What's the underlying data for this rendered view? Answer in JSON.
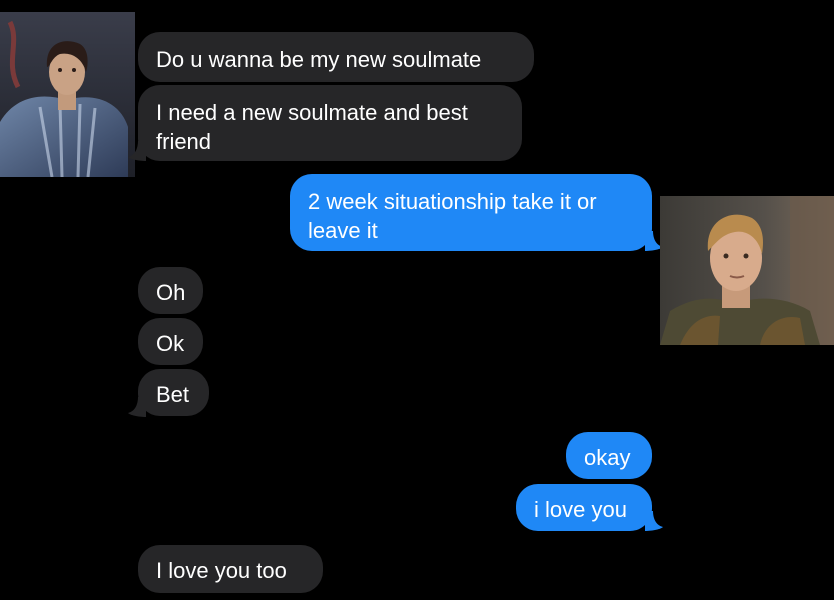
{
  "conversation": {
    "messages": [
      {
        "id": "m1",
        "direction": "received",
        "text": "Do u wanna be my new soulmate"
      },
      {
        "id": "m2",
        "direction": "received",
        "text": "I need a new soulmate and best friend"
      },
      {
        "id": "m3",
        "direction": "sent",
        "text": "2 week situationship take it or leave it"
      },
      {
        "id": "m4",
        "direction": "received",
        "text": "Oh"
      },
      {
        "id": "m5",
        "direction": "received",
        "text": "Ok"
      },
      {
        "id": "m6",
        "direction": "received",
        "text": "Bet"
      },
      {
        "id": "m7",
        "direction": "sent",
        "text": "okay"
      },
      {
        "id": "m8",
        "direction": "sent",
        "text": "i love you"
      },
      {
        "id": "m9",
        "direction": "received",
        "text": "I love you too"
      }
    ]
  },
  "colors": {
    "background": "#000000",
    "received_bubble": "#262628",
    "sent_bubble": "#1f88f6",
    "text": "#ffffff"
  }
}
